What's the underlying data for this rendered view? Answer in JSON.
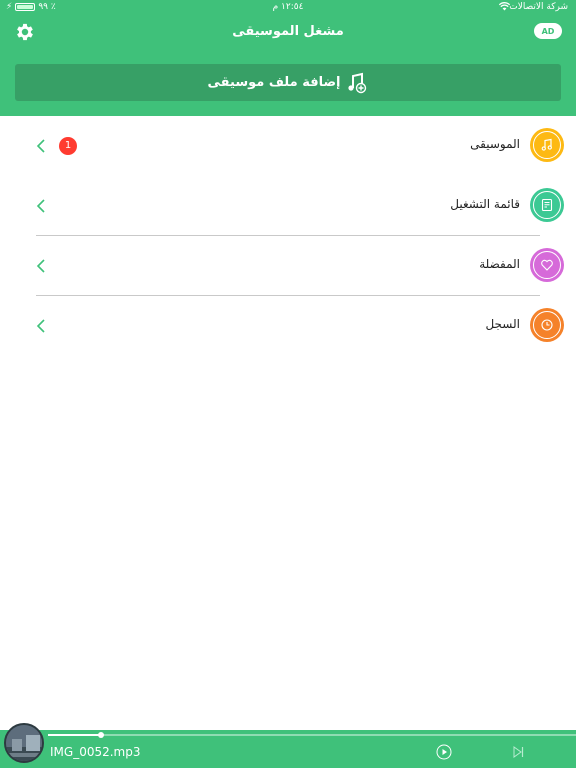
{
  "status_bar": {
    "carrier": "شركة الاتصالات",
    "time": "١٢:٥٤ م",
    "battery_percent": "٩٩ ٪",
    "battery_level": 0.99
  },
  "header": {
    "title": "مشغل الموسيقى",
    "ad_toggle_label": "AD",
    "add_button_label": "إضافة ملف موسيقى"
  },
  "menu": {
    "items": [
      {
        "label": "الموسيقى",
        "badge": "1",
        "color": "#fdb913"
      },
      {
        "label": "قائمة التشغيل",
        "color": "#3cc994"
      },
      {
        "label": "المفضلة",
        "color": "#d66ad9"
      },
      {
        "label": "السجل",
        "color": "#f5822a"
      }
    ]
  },
  "player": {
    "track_name": "IMG_0052.mp3",
    "progress": 0.1
  },
  "colors": {
    "brand": "#3fc17a",
    "brand_dark": "#37a066",
    "badge": "#ff3b30"
  }
}
